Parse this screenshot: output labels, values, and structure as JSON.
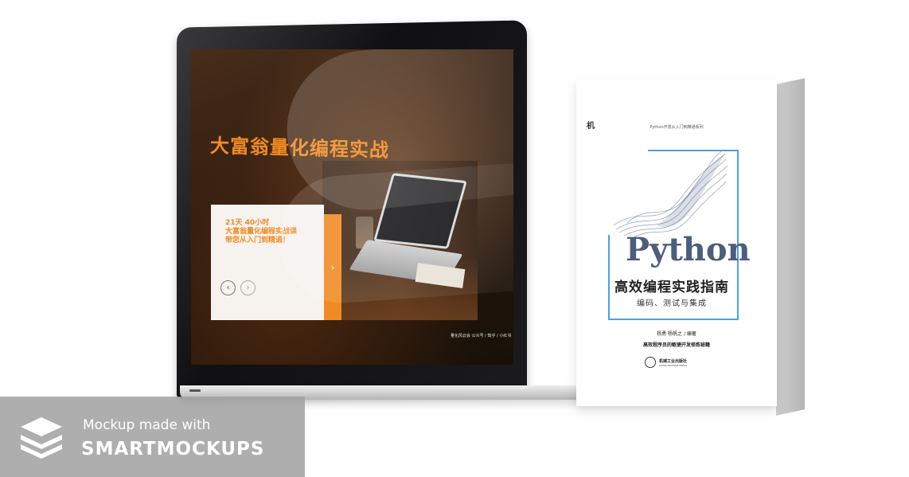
{
  "laptop": {
    "slide": {
      "title": "大富翁量化编程实战",
      "card_text": "21天 40小时\n大富翁量化编程实战课\n带您从入门到精通！",
      "prev_icon": "chevron-left-icon",
      "next_icon": "chevron-right-icon",
      "bar_icon": "chevron-right-icon",
      "prev_glyph": "‹",
      "next_glyph": "›",
      "bar_glyph": "›",
      "caption": "量化风云会 公众号 / 知乎 / 小红书"
    }
  },
  "book": {
    "series": "Python开发从入门到精通系列",
    "publisher_mark": "机",
    "python": "Python",
    "title": "高效编程实践指南",
    "subtitle": "编码、测试与集成",
    "authors": "杨勇  杨帆之 / 编著",
    "tagline": "高效程序员的敏捷开发修炼秘籍",
    "press_cn": "机械工业出版社",
    "press_en": "CHINA MACHINE PRESS"
  },
  "badge": {
    "line1": "Mockup made with",
    "line2": "SMARTMOCKUPS",
    "icon": "stacked-layers-icon"
  },
  "colors": {
    "accent_orange": "#f08a22",
    "frame_blue": "#4aa0e6",
    "python_slate": "#4d5d7d",
    "badge_gray": "#a0a0a0"
  }
}
